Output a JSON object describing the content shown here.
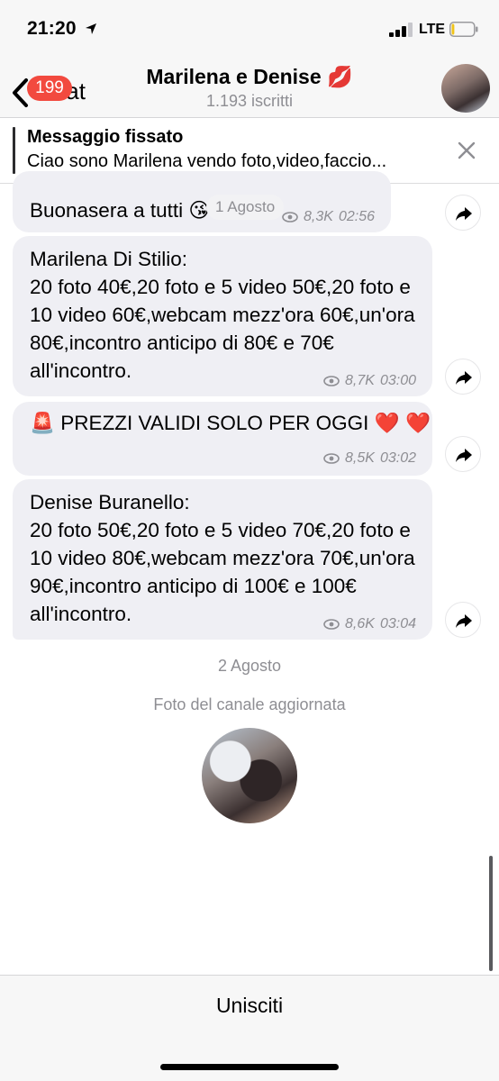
{
  "status_bar": {
    "time": "21:20",
    "network": "LTE",
    "signal_bars_filled": 3,
    "battery_level": 0.12
  },
  "header": {
    "back_label": "Chat",
    "unread_count": "199",
    "title": "Marilena e Denise 💋",
    "subtitle": "1.193 iscritti"
  },
  "pinned": {
    "title": "Messaggio fissato",
    "text": "Ciao sono Marilena vendo foto,video,faccio..."
  },
  "messages": [
    {
      "text": "Buonasera a tutti 😘",
      "views": "8,3K",
      "time": "02:56"
    },
    {
      "text": "Marilena Di Stilio:\n20 foto 40€,20 foto e 5 video 50€,20 foto e 10 video 60€,webcam mezz'ora 60€,un'ora 80€,incontro anticipo di 80€ e 70€ all'incontro.",
      "views": "8,7K",
      "time": "03:00"
    },
    {
      "text": "🚨 PREZZI VALIDI SOLO PER OGGI ❤️ ❤️",
      "views": "8,5K",
      "time": "03:02"
    },
    {
      "text": "Denise Buranello:\n20 foto 50€,20 foto e 5 video 70€,20 foto e 10 video 80€,webcam mezz'ora 70€,un'ora 90€,incontro anticipo di 100€ e 100€ all'incontro.",
      "views": "8,6K",
      "time": "03:04"
    }
  ],
  "floating_date": "1 Agosto",
  "date_separator": "2 Agosto",
  "service_message": "Foto del canale aggiornata",
  "bottom": {
    "join_label": "Unisciti"
  },
  "colors": {
    "badge": "#f24a3f",
    "bubble": "#efeff4",
    "meta": "#8e8e93"
  }
}
